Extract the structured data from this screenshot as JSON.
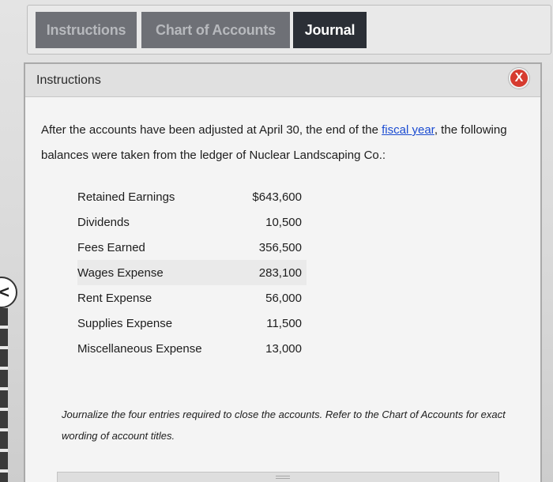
{
  "tabs": [
    {
      "label": "Instructions",
      "active": false
    },
    {
      "label": "Chart of Accounts",
      "active": false
    },
    {
      "label": "Journal",
      "active": true
    }
  ],
  "panel": {
    "title": "Instructions",
    "close_label": "X",
    "intro_before_link": "After the accounts have been adjusted at April 30, the end of the ",
    "intro_link": "fiscal year",
    "intro_after_link": ", the following balances were taken from the ledger of Nuclear Landscaping Co.:",
    "ledger": [
      {
        "account": "Retained Earnings",
        "amount": "$643,600"
      },
      {
        "account": "Dividends",
        "amount": "10,500"
      },
      {
        "account": "Fees Earned",
        "amount": "356,500"
      },
      {
        "account": "Wages Expense",
        "amount": "283,100"
      },
      {
        "account": "Rent Expense",
        "amount": "56,000"
      },
      {
        "account": "Supplies Expense",
        "amount": "11,500"
      },
      {
        "account": "Miscellaneous Expense",
        "amount": "13,000"
      }
    ],
    "note": "Journalize the four entries required to close the accounts. Refer to the Chart of Accounts for exact wording of account titles."
  },
  "nav": {
    "back_arrow": "<"
  },
  "colors": {
    "active_tab": "#2b2f36",
    "inactive_tab": "#6e7076",
    "close_button": "#d63b2f",
    "link": "#1a4bd1"
  }
}
